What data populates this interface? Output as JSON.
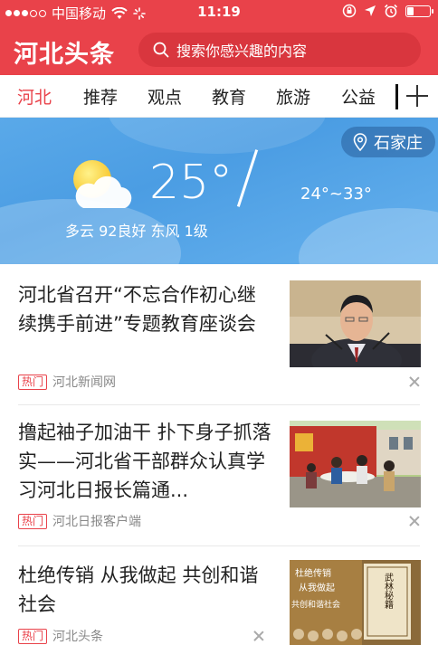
{
  "status_bar": {
    "carrier": "中国移动",
    "time": "11:19"
  },
  "header": {
    "logo": "河北头条",
    "search_placeholder": "搜索你感兴趣的内容"
  },
  "tabs": [
    {
      "label": "河北",
      "active": true
    },
    {
      "label": "推荐",
      "active": false
    },
    {
      "label": "观点",
      "active": false
    },
    {
      "label": "教育",
      "active": false
    },
    {
      "label": "旅游",
      "active": false
    },
    {
      "label": "公益",
      "active": false
    }
  ],
  "weather": {
    "location": "石家庄",
    "temperature": "25°",
    "range": "24°~33°",
    "condition": "多云 92良好 东风 1级",
    "icon": "partly-cloudy-icon"
  },
  "news": [
    {
      "title": "河北省召开“不忘合作初心继续携手前进”专题教育座谈会",
      "badge": "热门",
      "source": "河北新闻网"
    },
    {
      "title": "撸起袖子加油干 扑下身子抓落实——河北省干部群众认真学习河北日报长篇通...",
      "badge": "热门",
      "source": "河北日报客户端"
    },
    {
      "title": "杜绝传销 从我做起 共创和谐社会",
      "badge": "热门",
      "source": "河北头条"
    }
  ],
  "thumb3_text": {
    "lines": [
      "杜绝传销",
      "从我做起",
      "共创和谐社会"
    ],
    "book": "武林秘籍"
  },
  "colors": {
    "brand": "#e9424a",
    "sky": "#4b9de3"
  }
}
